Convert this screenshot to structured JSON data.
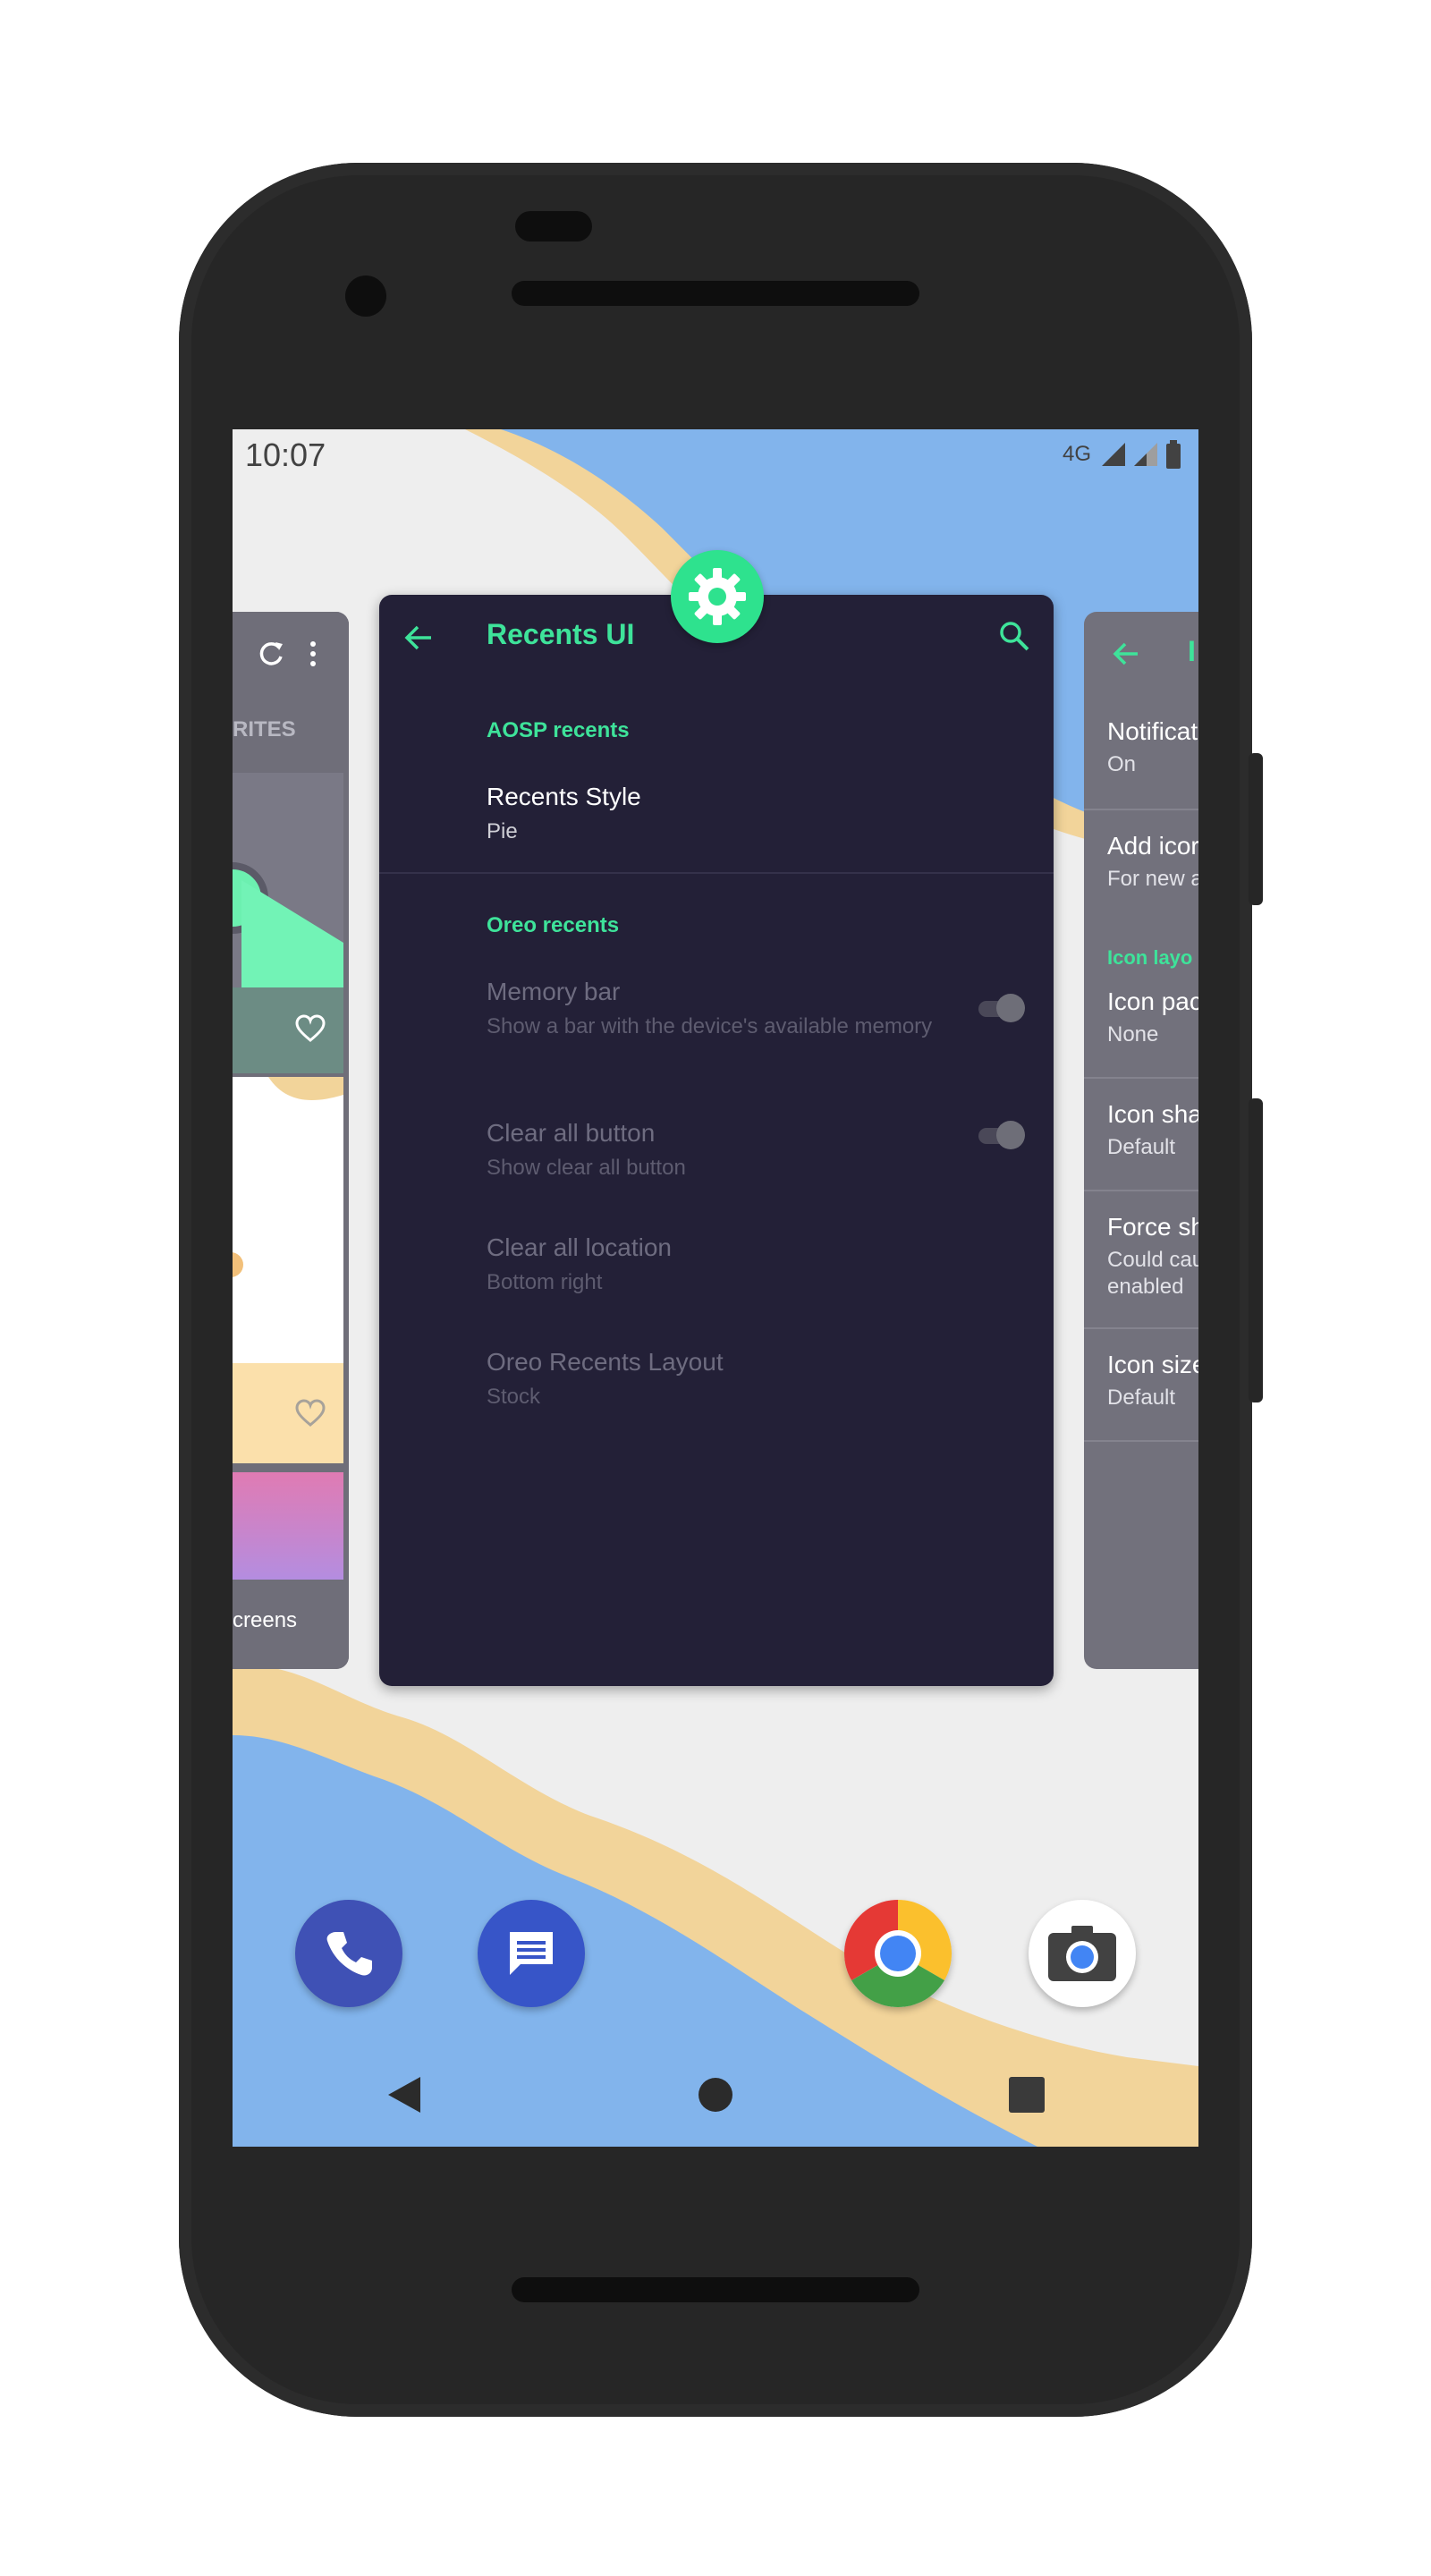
{
  "status_bar": {
    "time": "10:07",
    "network": "4G"
  },
  "left_card": {
    "tab_label": "RITES",
    "footer_label": "creens"
  },
  "main_card": {
    "title": "Recents UI",
    "sections": [
      {
        "header": "AOSP recents",
        "items": [
          {
            "title": "Recents Style",
            "subtitle": "Pie",
            "enabled": true
          }
        ]
      },
      {
        "header": "Oreo recents",
        "items": [
          {
            "title": "Memory bar",
            "subtitle": "Show a bar with the device's available memory",
            "enabled": false,
            "toggle": true
          },
          {
            "title": "Clear all button",
            "subtitle": "Show clear all button",
            "enabled": false,
            "toggle": true
          },
          {
            "title": "Clear all location",
            "subtitle": "Bottom right",
            "enabled": false
          },
          {
            "title": "Oreo Recents Layout",
            "subtitle": "Stock",
            "enabled": false
          }
        ]
      }
    ]
  },
  "right_card": {
    "title": "I",
    "items": [
      {
        "title": "Notificat",
        "subtitle": "On"
      },
      {
        "title": "Add icor",
        "subtitle": "For new a"
      },
      {
        "header": "Icon layo"
      },
      {
        "title": "Icon pac",
        "subtitle": "None"
      },
      {
        "title": "Icon sha",
        "subtitle": "Default"
      },
      {
        "title": "Force sh",
        "subtitle": "Could cau",
        "subtitle2": "enabled"
      },
      {
        "title": "Icon size",
        "subtitle": "Default"
      }
    ]
  },
  "dock": [
    "phone",
    "messages",
    "chrome",
    "camera"
  ],
  "colors": {
    "accent": "#3ee39a",
    "card_bg": "#232037",
    "phone_body": "#262626"
  }
}
